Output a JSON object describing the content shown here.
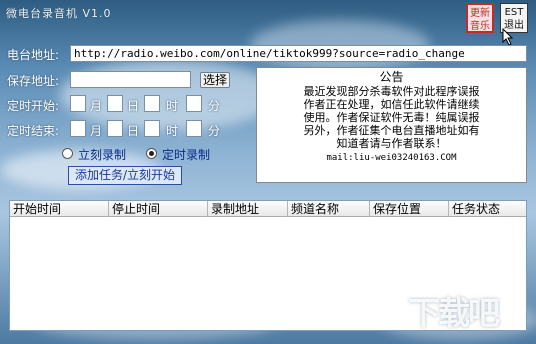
{
  "window": {
    "title": "微电台录音机 V1.0"
  },
  "top_buttons": {
    "red_label_1": "更新",
    "red_label_2": "音乐",
    "exit_label_1": "EST",
    "exit_label_2": "退出"
  },
  "form": {
    "station_label": "电台地址:",
    "station_value": "http://radio.weibo.com/online/tiktok999?source=radio_change",
    "save_label": "保存地址:",
    "save_value": "",
    "select_button": "选择",
    "start_label": "定时开始:",
    "end_label": "定时结束:",
    "unit_month": "月",
    "unit_day": "日",
    "unit_hour": "时",
    "unit_minute": "分",
    "radio_now": "立刻录制",
    "radio_timed": "定时录制",
    "add_button": "添加任务/立刻开始"
  },
  "notice": {
    "title": "公告",
    "line1": "最近发现部分杀毒软件对此程序误报",
    "line2": "作者正在处理，如信任此软件请继续",
    "line3": "使用。作者保证软件无毒！纯属误报",
    "line4": "另外，作者征集个电台直播地址如有",
    "line5": "知道者请与作者联系！",
    "mail": "mail:liu-wei03240163.COM"
  },
  "table": {
    "columns": [
      "开始时间",
      "停止时间",
      "录制地址",
      "频道名称",
      "保存位置",
      "任务状态"
    ]
  },
  "watermark": {
    "main": "下载吧",
    "sub": "www.xiazaiba.com"
  }
}
